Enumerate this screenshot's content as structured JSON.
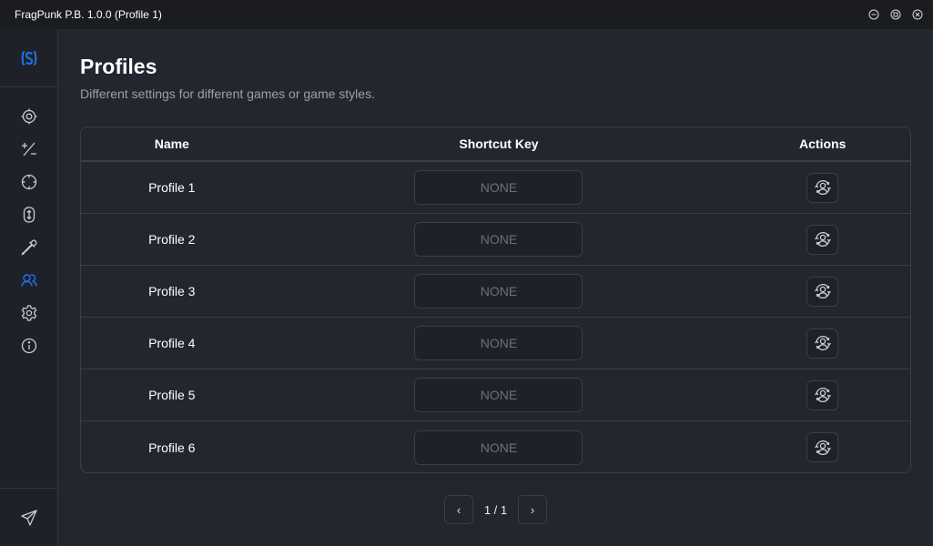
{
  "window": {
    "title": "FragPunk P.B. 1.0.0 (Profile 1)",
    "controls": [
      {
        "name": "minimize-icon"
      },
      {
        "name": "maximize-icon"
      },
      {
        "name": "close-icon"
      }
    ]
  },
  "sidebar": {
    "logo": "app-logo",
    "active_color": "#1f6fe5",
    "icon_color": "#c8ccd2",
    "items": [
      {
        "id": "aim",
        "icon": "target-icon",
        "active": false
      },
      {
        "id": "adjust",
        "icon": "plus-minus-icon",
        "active": false
      },
      {
        "id": "crosshair",
        "icon": "crosshair-icon",
        "active": false
      },
      {
        "id": "scroll",
        "icon": "mouse-scroll-icon",
        "active": false
      },
      {
        "id": "color-picker",
        "icon": "eyedropper-icon",
        "active": false
      },
      {
        "id": "profiles",
        "icon": "users-icon",
        "active": true
      },
      {
        "id": "settings",
        "icon": "gear-icon",
        "active": false
      },
      {
        "id": "about",
        "icon": "info-icon",
        "active": false
      }
    ],
    "bottom_item": {
      "id": "feedback",
      "icon": "send-icon"
    }
  },
  "page": {
    "title": "Profiles",
    "subtitle": "Different settings for different games or game styles."
  },
  "table": {
    "headers": {
      "name": "Name",
      "shortcut": "Shortcut Key",
      "actions": "Actions"
    },
    "rows": [
      {
        "name": "Profile 1",
        "shortcut": "NONE",
        "action_icon": "switch-profile-icon"
      },
      {
        "name": "Profile 2",
        "shortcut": "NONE",
        "action_icon": "switch-profile-icon"
      },
      {
        "name": "Profile 3",
        "shortcut": "NONE",
        "action_icon": "switch-profile-icon"
      },
      {
        "name": "Profile 4",
        "shortcut": "NONE",
        "action_icon": "switch-profile-icon"
      },
      {
        "name": "Profile 5",
        "shortcut": "NONE",
        "action_icon": "switch-profile-icon"
      },
      {
        "name": "Profile 6",
        "shortcut": "NONE",
        "action_icon": "switch-profile-icon"
      }
    ]
  },
  "pagination": {
    "prev": "‹",
    "next": "›",
    "current": "1 / 1"
  }
}
